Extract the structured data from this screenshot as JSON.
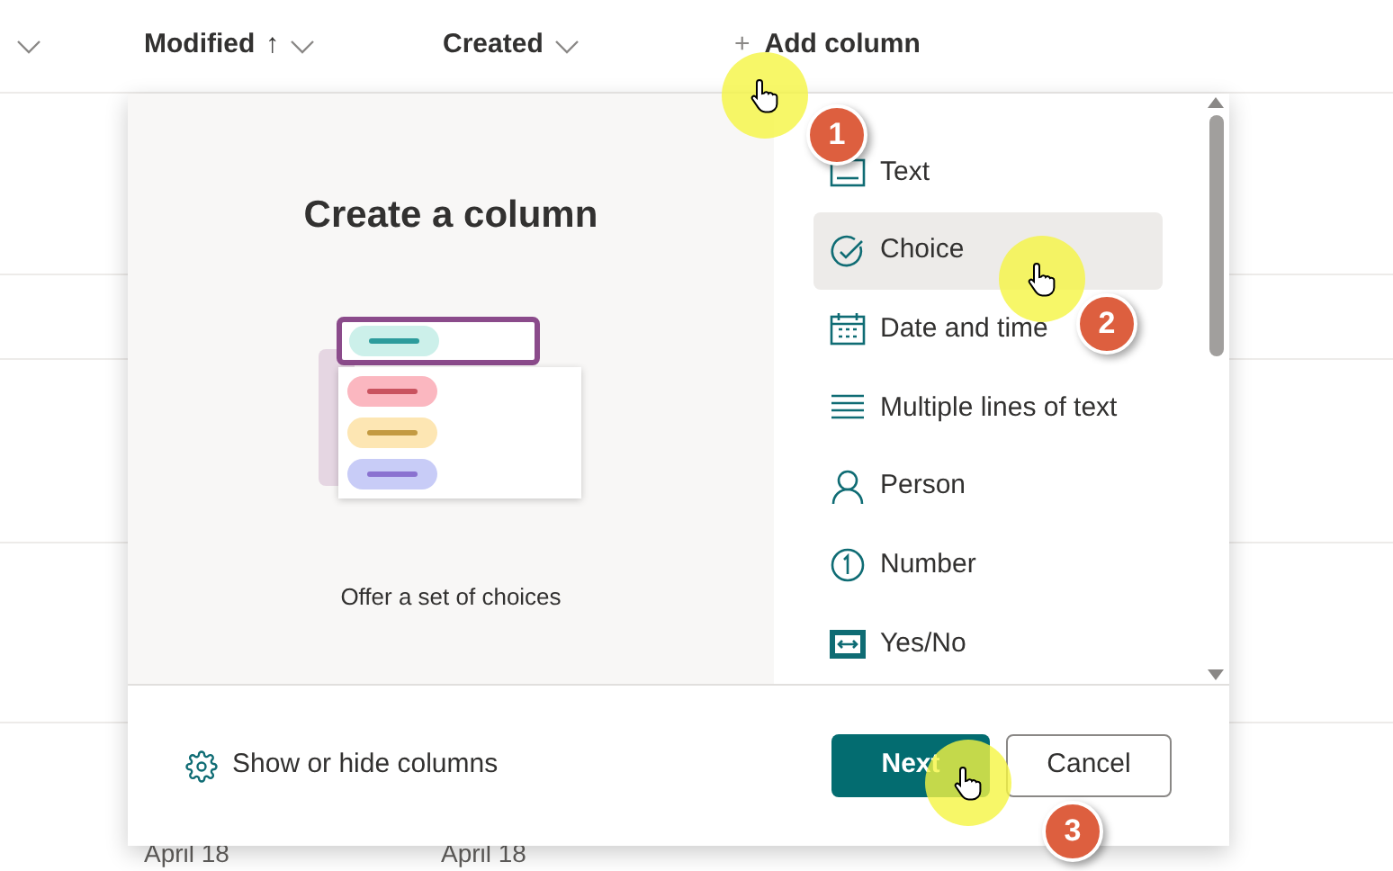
{
  "header": {
    "columns": [
      {
        "label": "Modified",
        "sort_arrow": "↑"
      },
      {
        "label": "Created"
      }
    ],
    "add_column": {
      "icon": "+",
      "label": "Add column"
    }
  },
  "rows": [
    {
      "cells": []
    },
    {
      "cells": []
    },
    {
      "cells": []
    },
    {
      "cells": []
    },
    {
      "cells": [
        "April 18",
        "April 18"
      ]
    }
  ],
  "panel": {
    "title": "Create a column",
    "description": "Offer a set of choices",
    "types": [
      {
        "kind": "text",
        "label": "Text",
        "selected": false
      },
      {
        "kind": "choice",
        "label": "Choice",
        "selected": true
      },
      {
        "kind": "date",
        "label": "Date and time",
        "selected": false
      },
      {
        "kind": "multiline",
        "label": "Multiple lines of text",
        "selected": false
      },
      {
        "kind": "person",
        "label": "Person",
        "selected": false
      },
      {
        "kind": "number",
        "label": "Number",
        "selected": false
      },
      {
        "kind": "yesno",
        "label": "Yes/No",
        "selected": false
      }
    ],
    "show_hide": "Show or hide columns",
    "buttons": {
      "primary": "Next",
      "secondary": "Cancel"
    }
  },
  "annotations": [
    {
      "number": "1"
    },
    {
      "number": "2"
    },
    {
      "number": "3"
    }
  ]
}
